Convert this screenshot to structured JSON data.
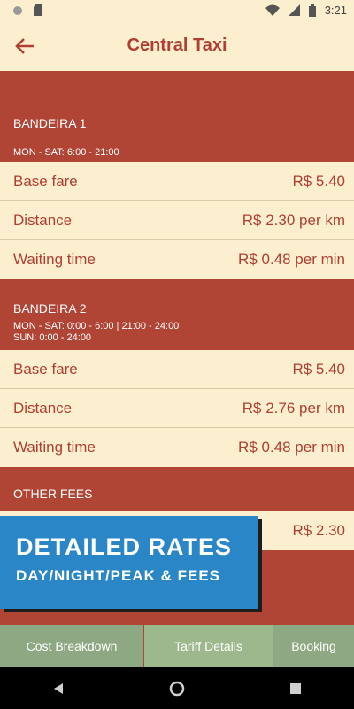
{
  "status": {
    "time": "3:21"
  },
  "appbar": {
    "title": "Central Taxi"
  },
  "sections": [
    {
      "name": "BANDEIRA 1",
      "hours": [
        "MON - SAT: 6:00 - 21:00"
      ],
      "rows": [
        {
          "label": "Base fare",
          "value": "R$ 5.40"
        },
        {
          "label": "Distance",
          "value": "R$ 2.30 per km"
        },
        {
          "label": "Waiting time",
          "value": "R$ 0.48 per min"
        }
      ]
    },
    {
      "name": "BANDEIRA 2",
      "hours": [
        "MON - SAT: 0:00 - 6:00 | 21:00 - 24:00",
        "SUN: 0:00 - 24:00"
      ],
      "rows": [
        {
          "label": "Base fare",
          "value": "R$ 5.40"
        },
        {
          "label": "Distance",
          "value": "R$ 2.76 per km"
        },
        {
          "label": "Waiting time",
          "value": "R$ 0.48 per min"
        }
      ]
    },
    {
      "name": "OTHER FEES",
      "hours": [],
      "rows": [
        {
          "label": "",
          "value": "R$ 2.30"
        }
      ]
    }
  ],
  "promo": {
    "line1": "DETAILED RATES",
    "line2": "DAY/NIGHT/PEAK & FEES"
  },
  "tabs": [
    {
      "label": "Cost Breakdown",
      "active": false
    },
    {
      "label": "Tariff Details",
      "active": true
    },
    {
      "label": "Booking",
      "active": false
    }
  ],
  "colors": {
    "accent": "#b04536",
    "background": "#fcefcf",
    "promo": "#2a86c7",
    "tab": "#8fa884",
    "tab_active": "#9cb88c"
  },
  "icons": [
    "back-arrow-icon",
    "nav-back-icon",
    "nav-home-icon",
    "nav-recents-icon"
  ]
}
